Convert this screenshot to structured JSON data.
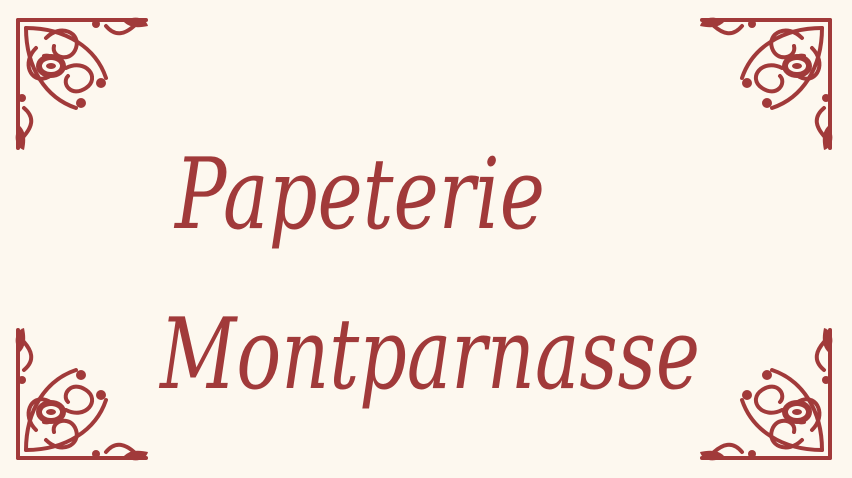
{
  "sign": {
    "line1": "Papeterie",
    "line2": "Montparnasse"
  },
  "colors": {
    "background": "#fdf8ef",
    "ink": "#a13a3a"
  },
  "ornaments": {
    "icon": "floral-corner-ornament-icon"
  }
}
